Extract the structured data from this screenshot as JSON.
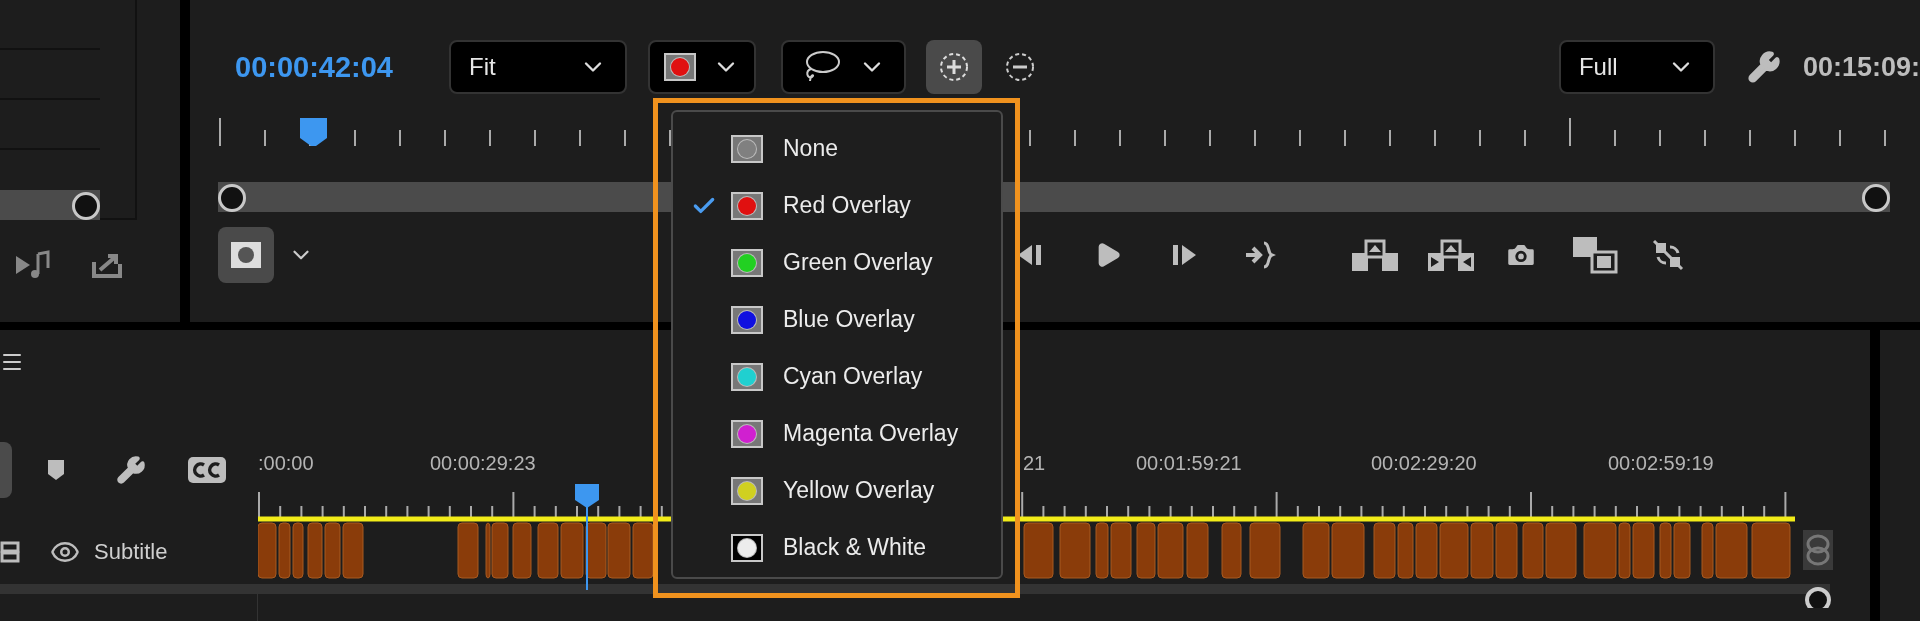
{
  "program_monitor": {
    "timecode": "00:00:42:04",
    "zoom_dropdown": {
      "value": "Fit"
    },
    "resolution_dropdown": {
      "value": "Full"
    },
    "duration": "00:15:09:"
  },
  "overlay_menu": {
    "items": [
      {
        "label": "None",
        "selected": false,
        "kind": "color",
        "color": "#808080"
      },
      {
        "label": "Red Overlay",
        "selected": true,
        "kind": "color",
        "color": "#e01010"
      },
      {
        "label": "Green Overlay",
        "selected": false,
        "kind": "color",
        "color": "#22d022"
      },
      {
        "label": "Blue Overlay",
        "selected": false,
        "kind": "color",
        "color": "#1010e0"
      },
      {
        "label": "Cyan Overlay",
        "selected": false,
        "kind": "color",
        "color": "#20d0d0"
      },
      {
        "label": "Magenta Overlay",
        "selected": false,
        "kind": "color",
        "color": "#d020d0"
      },
      {
        "label": "Yellow Overlay",
        "selected": false,
        "kind": "color",
        "color": "#d0d020"
      },
      {
        "label": "Black & White",
        "selected": false,
        "kind": "mono",
        "color": "#ececec"
      }
    ]
  },
  "timeline": {
    "ruler_labels": [
      ":00:00",
      "00:00:29:23",
      "21",
      "00:01:59:21",
      "00:02:29:20",
      "00:02:59:19"
    ],
    "track": {
      "name": "Subtitle"
    }
  }
}
